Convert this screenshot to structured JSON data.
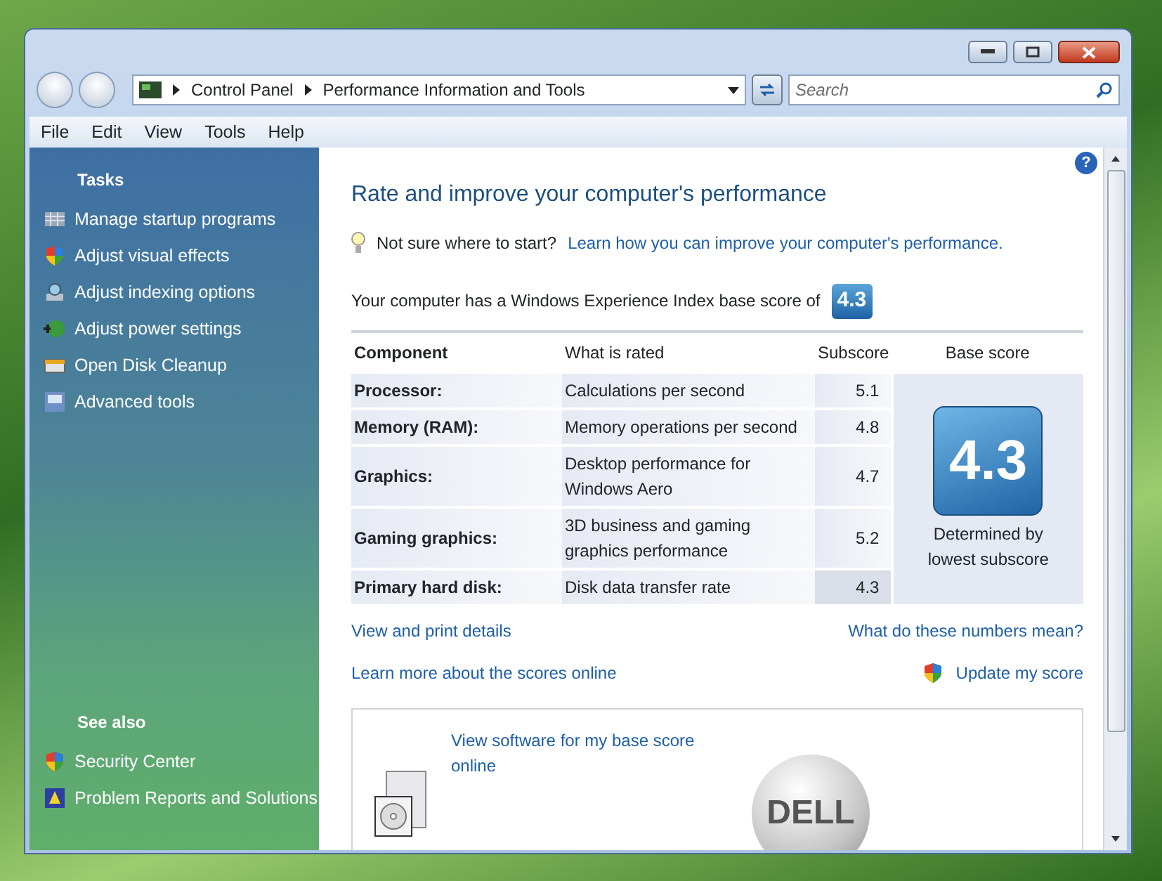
{
  "address_bar": {
    "breadcrumbs": [
      "Control Panel",
      "Performance Information and Tools"
    ]
  },
  "search": {
    "placeholder": "Search"
  },
  "menu": [
    "File",
    "Edit",
    "View",
    "Tools",
    "Help"
  ],
  "sidebar": {
    "tasks_title": "Tasks",
    "tasks": [
      {
        "label": "Manage startup programs"
      },
      {
        "label": "Adjust visual effects"
      },
      {
        "label": "Adjust indexing options"
      },
      {
        "label": "Adjust power settings"
      },
      {
        "label": "Open Disk Cleanup"
      },
      {
        "label": "Advanced tools"
      }
    ],
    "see_also_title": "See also",
    "see_also": [
      {
        "label": "Security Center"
      },
      {
        "label": "Problem Reports and Solutions"
      }
    ]
  },
  "content": {
    "help_button": "?",
    "heading": "Rate and improve your computer's performance",
    "tip": {
      "question": "Not sure where to start?",
      "link": "Learn how you can improve your computer's performance."
    },
    "score_line": "Your computer has a Windows Experience Index base score of",
    "score_badge": "4.3",
    "table": {
      "columns": [
        "Component",
        "What is rated",
        "Subscore",
        "Base score"
      ],
      "rows": [
        {
          "component": "Processor:",
          "rated": "Calculations per second",
          "subscore": "5.1",
          "lowest": false
        },
        {
          "component": "Memory (RAM):",
          "rated": "Memory operations per second",
          "subscore": "4.8",
          "lowest": false
        },
        {
          "component": "Graphics:",
          "rated": "Desktop performance for Windows Aero",
          "subscore": "4.7",
          "lowest": false
        },
        {
          "component": "Gaming graphics:",
          "rated": "3D business and gaming graphics performance",
          "subscore": "5.2",
          "lowest": false
        },
        {
          "component": "Primary hard disk:",
          "rated": "Disk data transfer rate",
          "subscore": "4.3",
          "lowest": true
        }
      ],
      "base_score": "4.3",
      "base_note": "Determined by lowest subscore"
    },
    "links": [
      {
        "left": "View and print details",
        "right": "What do these numbers mean?",
        "shield": false
      },
      {
        "left": "Learn more about the scores online",
        "right": "Update my score",
        "shield": true
      }
    ],
    "software_box": {
      "link": "View software for my base score online",
      "logo_text": "DELL"
    }
  }
}
